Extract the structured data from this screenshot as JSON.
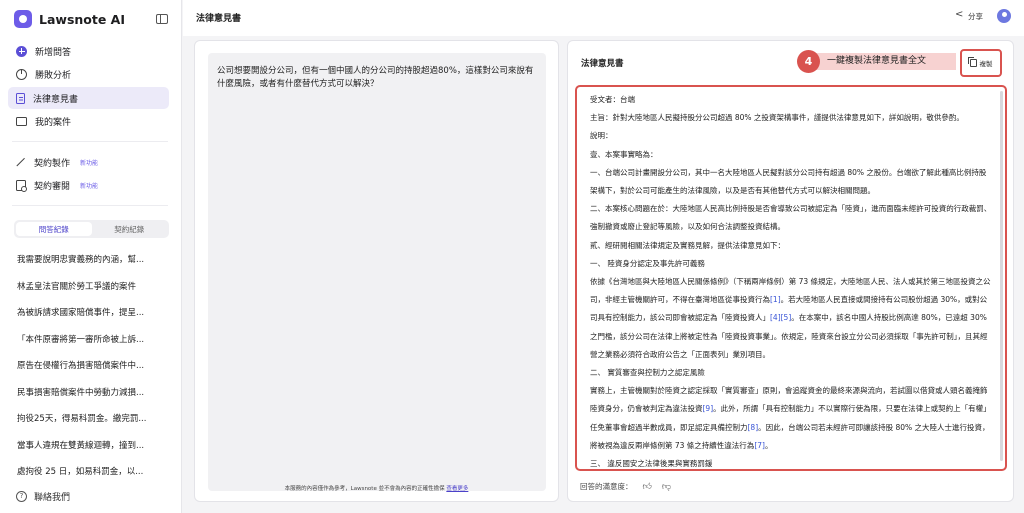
{
  "app": {
    "name": "Lawsnote AI"
  },
  "sidebar": {
    "nav": [
      {
        "label": "新增問答",
        "icon": "plus-circle-icon"
      },
      {
        "label": "勝敗分析",
        "icon": "pie-chart-icon"
      },
      {
        "label": "法律意見書",
        "icon": "document-icon",
        "active": true
      },
      {
        "label": "我的案件",
        "icon": "folder-icon"
      }
    ],
    "tools": [
      {
        "label": "契約製作",
        "tag": "新功能",
        "icon": "pen-icon"
      },
      {
        "label": "契約審閱",
        "tag": "新功能",
        "icon": "contract-review-icon"
      }
    ],
    "tabs": [
      {
        "label": "問答紀錄",
        "active": true
      },
      {
        "label": "契約紀錄"
      }
    ],
    "history": [
      "我需要說明忠實義務的內涵，幫...",
      "林孟皇法官關於勞工爭議的案件",
      "為被訴請求國家賠償事件，提呈...",
      "「本件原審將第一審所命被上訴...",
      "原告在侵權行為損害賠償案件中...",
      "民事損害賠償案件中勞動力減損...",
      "拘役25天，得易科罰金。繳完罰...",
      "當事人違規在雙黃線迴轉，撞到...",
      "處拘役 25 日，如易科罰金，以..."
    ],
    "contact": "聯絡我們"
  },
  "header": {
    "title": "法律意見書",
    "share_label": "分享"
  },
  "question": {
    "text": "公司想要開設分公司，但有一個中國人的分公司的持股超過80%，這樣對公司來說有什麼風險，或者有什麼替代方式可以解決？",
    "disclaimer": "本服務的內容僅作為參考，Lawsnote 並不會為內容的正確性擔保",
    "more_label": "查看更多"
  },
  "answer": {
    "title": "法律意見書",
    "step_number": "4",
    "callout": "一鍵複製法律意見書全文",
    "copy_label": "複製",
    "rating_label": "回答的滿意度：",
    "lines": [
      "受文者：台端",
      "主旨：針對大陸地區人民擬持股分公司超過 80% 之投資架構事件，謹提供法律意見如下，詳如說明，敬供參酌。",
      "說明：",
      "壹、本案事實略為：",
      "一、台端公司計畫開設分公司，其中一名大陸地區人民擬對該分公司持有超過 80% 之股份。台端欲了解此種高比例持股架構下，對於公司可能產生的法律風險，以及是否有其他替代方式可以解決相關問題。",
      "二、本案核心問題在於：大陸地區人民高比例持股是否會導致公司被認定為「陸資」，進而面臨未經許可投資的行政裁罰、強制撤資或廢止登記等風險，以及如何合法調整投資結構。",
      "貳、經研閱相關法律規定及實務見解，提供法律意見如下：",
      "一、 陸資身分認定及事先許可義務",
      "依據《台灣地區與大陸地區人民關係條例》（下稱兩岸條例）第 73 條規定，大陸地區人民、法人或其於第三地區投資之公司，非經主管機關許可，不得在臺灣地區從事投資行為",
      "[1]",
      "。若大陸地區人民直接或間接持有公司股份超過 30%，或對公司具有控制能力，該公司即會被認定為「陸資投資人」",
      "[4][5]",
      "。在本案中，該名中國人持股比例高達 80%，已遠超 30% 之門檻，該分公司在法律上將被定性為「陸資投資事業」。依規定，陸資來台設立分公司必須採取「事先許可制」，且其經營之業務必須符合政府公告之「正面表列」業別項目。",
      "二、 實質審查與控制力之認定風險",
      "實務上，主管機關對於陸資之認定採取「實質審查」原則，會追蹤資金的最終來源與流向，若試圖以借貸或人頭名義掩飾陸資身分，仍會被判定為違法投資",
      "[9]",
      "。此外，所謂「具有控制能力」不以實際行使為限，只要在法律上或契約上「有權」任免董事會超過半數成員，即足認定具備控制力",
      "[8]",
      "。因此，台端公司若未經許可即讓該持股 80% 之大陸人士進行投資，將被視為違反兩岸條例第 73 條之持續性違法行為",
      "[7]",
      "。",
      "三、 違反國安之法律後果與實務罰鍰"
    ]
  },
  "colors": {
    "accent": "#5b4fd6",
    "highlight": "#d9534f",
    "callout_bg": "#f7d2d1"
  }
}
